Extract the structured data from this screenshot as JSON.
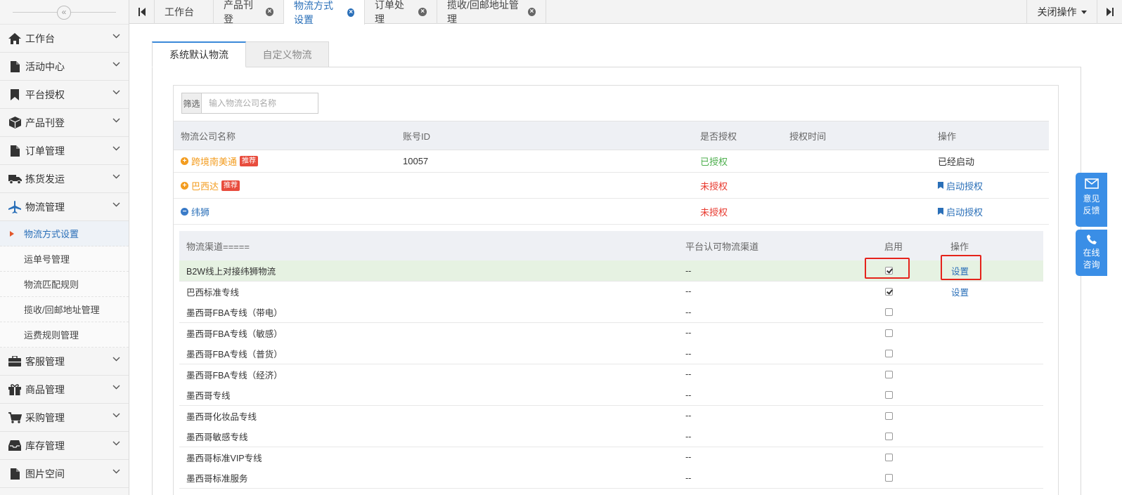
{
  "sidebar": {
    "collapse_glyph": "«",
    "items": [
      {
        "label": "工作台",
        "icon": "home-icon"
      },
      {
        "label": "活动中心",
        "icon": "file-icon"
      },
      {
        "label": "平台授权",
        "icon": "bookmark-icon"
      },
      {
        "label": "产品刊登",
        "icon": "cube-icon"
      },
      {
        "label": "订单管理",
        "icon": "file-icon"
      },
      {
        "label": "拣货发运",
        "icon": "truck-icon"
      },
      {
        "label": "物流管理",
        "icon": "plane-icon"
      }
    ],
    "sub_items": [
      {
        "label": "物流方式设置"
      },
      {
        "label": "运单号管理"
      },
      {
        "label": "物流匹配规则"
      },
      {
        "label": "揽收/回邮地址管理"
      },
      {
        "label": "运费规则管理"
      }
    ],
    "items_after": [
      {
        "label": "客服管理",
        "icon": "briefcase-icon"
      },
      {
        "label": "商品管理",
        "icon": "gift-icon"
      },
      {
        "label": "采购管理",
        "icon": "cart-icon"
      },
      {
        "label": "库存管理",
        "icon": "inbox-icon"
      },
      {
        "label": "图片空间",
        "icon": "file-icon"
      }
    ]
  },
  "topbar": {
    "tabs": [
      {
        "label": "工作台",
        "closable": false
      },
      {
        "label": "产品刊登",
        "closable": true
      },
      {
        "label": "物流方式设置",
        "closable": true
      },
      {
        "label": "订单处理",
        "closable": true
      },
      {
        "label": "揽收/回邮地址管理",
        "closable": true
      }
    ],
    "close_x": "×",
    "close_ops_label": "关闭操作"
  },
  "inner_tabs": {
    "active": "系统默认物流",
    "inactive": "自定义物流"
  },
  "filter": {
    "label": "筛选",
    "placeholder": "输入物流公司名称"
  },
  "company_table": {
    "headers": {
      "name": "物流公司名称",
      "account": "账号ID",
      "authorized": "是否授权",
      "auth_time": "授权时间",
      "ops": "操作"
    },
    "rows": [
      {
        "name": "跨境南美通",
        "badge": "推荐",
        "account": "10057",
        "status": "已授权",
        "time": "",
        "op": "已经启动",
        "expand": "+"
      },
      {
        "name": "巴西达",
        "badge": "推荐",
        "account": "",
        "status": "未授权",
        "time": "",
        "op": "启动授权",
        "expand": "+"
      },
      {
        "name": "纬狮",
        "badge": "",
        "account": "",
        "status": "未授权",
        "time": "",
        "op": "启动授权",
        "expand": "−"
      }
    ]
  },
  "channel_table": {
    "headers": {
      "channel": "物流渠道=====",
      "platform": "平台认可物流渠道",
      "enabled": "启用",
      "ops": "操作"
    },
    "rows": [
      {
        "name": "B2W线上对接纬狮物流",
        "platform": "--",
        "checked": true,
        "op": "设置"
      },
      {
        "name": "巴西标准专线",
        "platform": "--",
        "checked": true,
        "op": "设置"
      },
      {
        "name": "墨西哥FBA专线（带电）",
        "platform": "--",
        "checked": false,
        "op": ""
      },
      {
        "name": "墨西哥FBA专线（敏感）",
        "platform": "--",
        "checked": false,
        "op": ""
      },
      {
        "name": "墨西哥FBA专线（普货）",
        "platform": "--",
        "checked": false,
        "op": ""
      },
      {
        "name": "墨西哥FBA专线（经济）",
        "platform": "--",
        "checked": false,
        "op": ""
      },
      {
        "name": "墨西哥专线",
        "platform": "--",
        "checked": false,
        "op": ""
      },
      {
        "name": "墨西哥化妆品专线",
        "platform": "--",
        "checked": false,
        "op": ""
      },
      {
        "name": "墨西哥敏感专线",
        "platform": "--",
        "checked": false,
        "op": ""
      },
      {
        "name": "墨西哥标准VIP专线",
        "platform": "--",
        "checked": false,
        "op": ""
      },
      {
        "name": "墨西哥标准服务",
        "platform": "--",
        "checked": false,
        "op": ""
      }
    ]
  },
  "float_widgets": {
    "feedback": [
      "意见",
      "反馈"
    ],
    "consult": [
      "在线",
      "咨询"
    ]
  },
  "colors": {
    "accent": "#2a6fb8",
    "orange": "#f39c1f",
    "green": "#4cae4c",
    "red": "#e8392e",
    "widget": "#3a8ee6"
  }
}
